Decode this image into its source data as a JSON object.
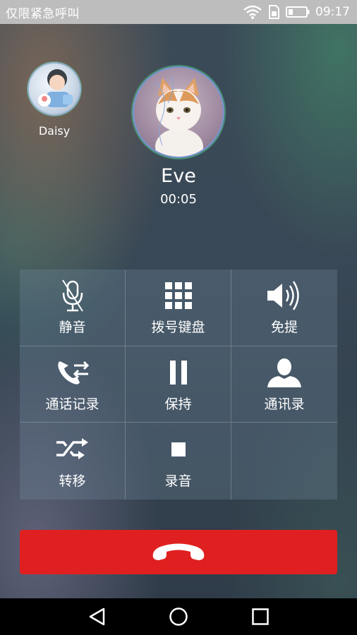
{
  "status_bar": {
    "carrier_text": "仅限紧急呼叫",
    "time": "09:17",
    "icons": [
      "wifi-icon",
      "sim-icon",
      "battery-icon"
    ]
  },
  "contacts": {
    "secondary": {
      "name": "Daisy"
    },
    "primary": {
      "name": "Eve",
      "duration": "00:05"
    }
  },
  "actions": [
    {
      "label": "静音",
      "icon": "mute-mic-icon"
    },
    {
      "label": "拨号键盘",
      "icon": "dialpad-icon"
    },
    {
      "label": "免提",
      "icon": "speaker-icon"
    },
    {
      "label": "通话记录",
      "icon": "call-log-icon"
    },
    {
      "label": "保持",
      "icon": "pause-icon"
    },
    {
      "label": "通讯录",
      "icon": "contacts-icon"
    },
    {
      "label": "转移",
      "icon": "transfer-icon"
    },
    {
      "label": "录音",
      "icon": "record-icon"
    }
  ],
  "end_call": {
    "icon": "hangup-icon",
    "color": "#e02020"
  },
  "nav": {
    "icons": [
      "back-icon",
      "home-icon",
      "recents-icon"
    ]
  }
}
